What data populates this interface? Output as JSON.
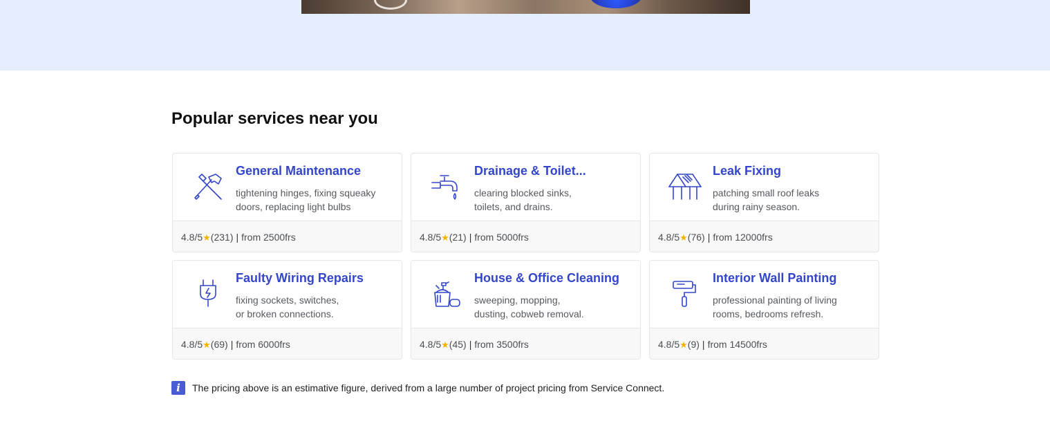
{
  "section": {
    "title": "Popular services near you"
  },
  "services": [
    {
      "title": "General Maintenance",
      "icon": "tools-icon",
      "desc_line1": "tightening hinges, fixing squeaky",
      "desc_line2": "doors, replacing light bulbs",
      "rating": "4.8/5",
      "reviews": "(231)",
      "price": "from 2500frs"
    },
    {
      "title": "Drainage & Toilet...",
      "icon": "faucet-icon",
      "desc_line1": "clearing blocked sinks,",
      "desc_line2": "toilets, and drains.",
      "rating": "4.8/5",
      "reviews": "(21)",
      "price": "from 5000frs"
    },
    {
      "title": "Leak Fixing",
      "icon": "roof-icon",
      "desc_line1": "patching small roof leaks",
      "desc_line2": "during rainy season.",
      "rating": "4.8/5",
      "reviews": "(76)",
      "price": "from 12000frs"
    },
    {
      "title": "Faulty Wiring Repairs",
      "icon": "plug-icon",
      "desc_line1": "fixing sockets, switches,",
      "desc_line2": "or broken connections.",
      "rating": "4.8/5",
      "reviews": "(69)",
      "price": "from 6000frs"
    },
    {
      "title": "House & Office Cleaning",
      "icon": "cleaning-icon",
      "desc_line1": "sweeping, mopping,",
      "desc_line2": "dusting, cobweb removal.",
      "rating": "4.8/5",
      "reviews": "(45)",
      "price": "from 3500frs"
    },
    {
      "title": "Interior Wall Painting",
      "icon": "paint-roller-icon",
      "desc_line1": "professional painting of living",
      "desc_line2": "rooms, bedrooms refresh.",
      "rating": "4.8/5",
      "reviews": "(9)",
      "price": "from 14500frs"
    }
  ],
  "star_glyph": "★",
  "separator": "|",
  "note": {
    "icon_glyph": "i",
    "text": "The pricing above is an estimative figure, derived from a large number of project pricing from Service Connect."
  },
  "colors": {
    "accent": "#3346c9",
    "hero_bg": "#e4eefd",
    "star": "#f2b400",
    "info": "#4a5bd6"
  }
}
